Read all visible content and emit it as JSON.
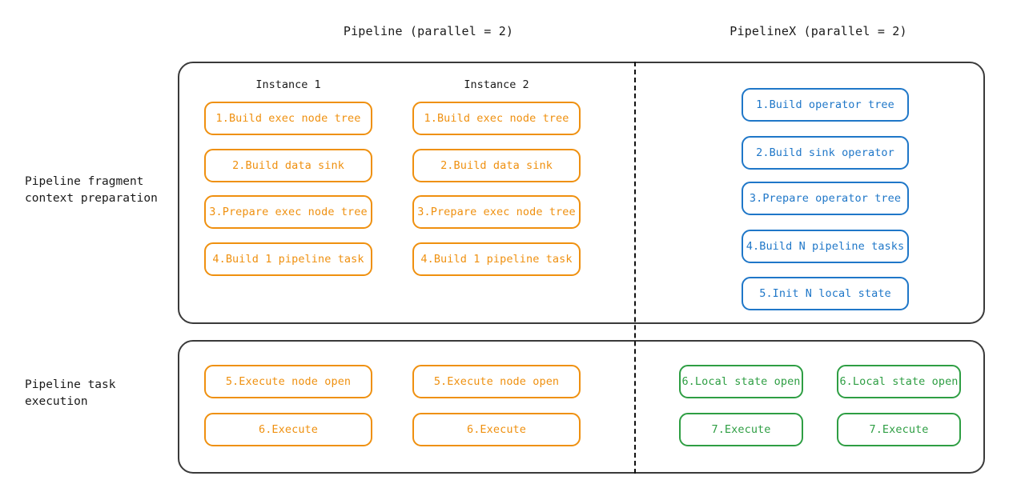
{
  "headers": {
    "left": "Pipeline (parallel = 2)",
    "right": "PipelineX (parallel = 2)"
  },
  "row_labels": {
    "preparation": "Pipeline fragment\ncontext preparation",
    "execution": "Pipeline task\nexecution"
  },
  "colors": {
    "orange": "#ef900f",
    "blue": "#1f77c8",
    "green": "#2e9e43",
    "container_border": "#3a3a3a",
    "divider": "#111111",
    "text": "#1a1a1a",
    "background": "#ffffff"
  },
  "preparation": {
    "pipeline": {
      "instances": [
        {
          "title": "Instance 1",
          "steps": [
            "1.Build exec node tree",
            "2.Build data sink",
            "3.Prepare exec node tree",
            "4.Build 1 pipeline task"
          ]
        },
        {
          "title": "Instance 2",
          "steps": [
            "1.Build exec node tree",
            "2.Build data sink",
            "3.Prepare exec node tree",
            "4.Build 1 pipeline task"
          ]
        }
      ]
    },
    "pipelinex": {
      "steps": [
        "1.Build operator tree",
        "2.Build sink operator",
        "3.Prepare operator tree",
        "4.Build N pipeline tasks",
        "5.Init N local state"
      ]
    }
  },
  "execution": {
    "pipeline": {
      "instances": [
        {
          "steps": [
            "5.Execute node open",
            "6.Execute"
          ]
        },
        {
          "steps": [
            "5.Execute node open",
            "6.Execute"
          ]
        }
      ]
    },
    "pipelinex": {
      "tasks": [
        {
          "steps": [
            "6.Local state open",
            "7.Execute"
          ]
        },
        {
          "steps": [
            "6.Local state open",
            "7.Execute"
          ]
        }
      ]
    }
  }
}
